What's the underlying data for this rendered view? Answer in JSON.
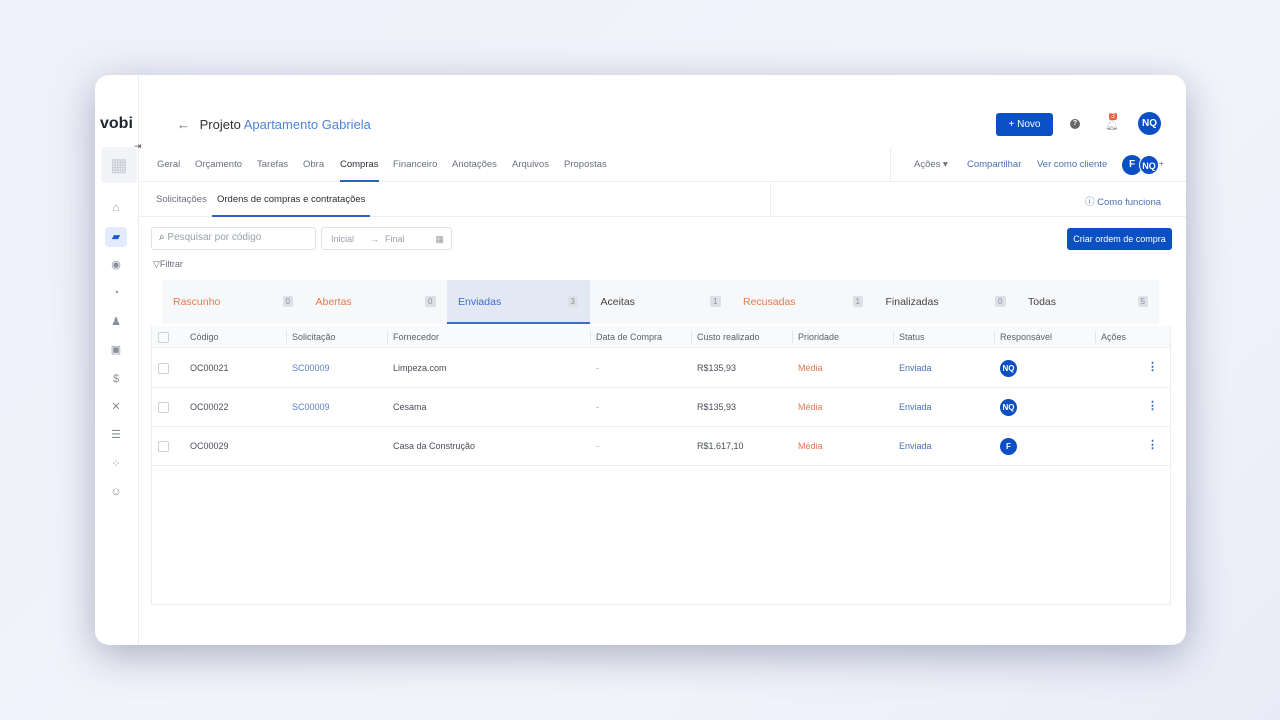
{
  "app": {
    "logo": "vobi"
  },
  "header": {
    "prefix": "Projeto",
    "project": "Apartamento Gabriela",
    "new_button": "+ Novo",
    "notifications": "3",
    "user_initials": "NQ"
  },
  "nav": {
    "tabs": [
      "Geral",
      "Orçamento",
      "Tarefas",
      "Obra",
      "Compras",
      "Financeiro",
      "Anotações",
      "Arquivos",
      "Propostas"
    ],
    "actions": "Ações",
    "share": "Compartilhar",
    "view_as_client": "Ver como cliente",
    "members": [
      "F",
      "NQ"
    ],
    "add_member": "+"
  },
  "subtabs": {
    "items": [
      "Solicitações",
      "Ordens de compras e contratações"
    ],
    "help": "Como funciona"
  },
  "toolbar": {
    "search_placeholder": "Pesquisar por código",
    "date_start": "Inicial",
    "date_end": "Final",
    "filter": "Filtrar",
    "create_button": "Criar ordem de compra"
  },
  "status_tabs": [
    {
      "label": "Rascunho",
      "count": "0",
      "color": "#e07b52"
    },
    {
      "label": "Abertas",
      "count": "0",
      "color": "#e07b52"
    },
    {
      "label": "Enviadas",
      "count": "3",
      "color": "#3d6bc9"
    },
    {
      "label": "Aceitas",
      "count": "1",
      "color": "#444"
    },
    {
      "label": "Recusadas",
      "count": "1",
      "color": "#e07b52"
    },
    {
      "label": "Finalizadas",
      "count": "0",
      "color": "#444"
    },
    {
      "label": "Todas",
      "count": "5",
      "color": "#444"
    }
  ],
  "table": {
    "columns": [
      "Código",
      "Solicitação",
      "Fornecedor",
      "Data de Compra",
      "Custo realizado",
      "Prioridade",
      "Status",
      "Responsável",
      "Ações"
    ],
    "rows": [
      {
        "code": "OC00021",
        "request": "SC00009",
        "supplier": "Limpeza.com",
        "date": "-",
        "cost": "R$135,93",
        "priority": "Média",
        "status": "Enviada",
        "owner": "NQ"
      },
      {
        "code": "OC00022",
        "request": "SC00009",
        "supplier": "Cesama",
        "date": "-",
        "cost": "R$135,93",
        "priority": "Média",
        "status": "Enviada",
        "owner": "NQ"
      },
      {
        "code": "OC00029",
        "request": "",
        "supplier": "Casa da Construção",
        "date": "-",
        "cost": "R$1.617,10",
        "priority": "Média",
        "status": "Enviada",
        "owner": "F"
      }
    ]
  }
}
